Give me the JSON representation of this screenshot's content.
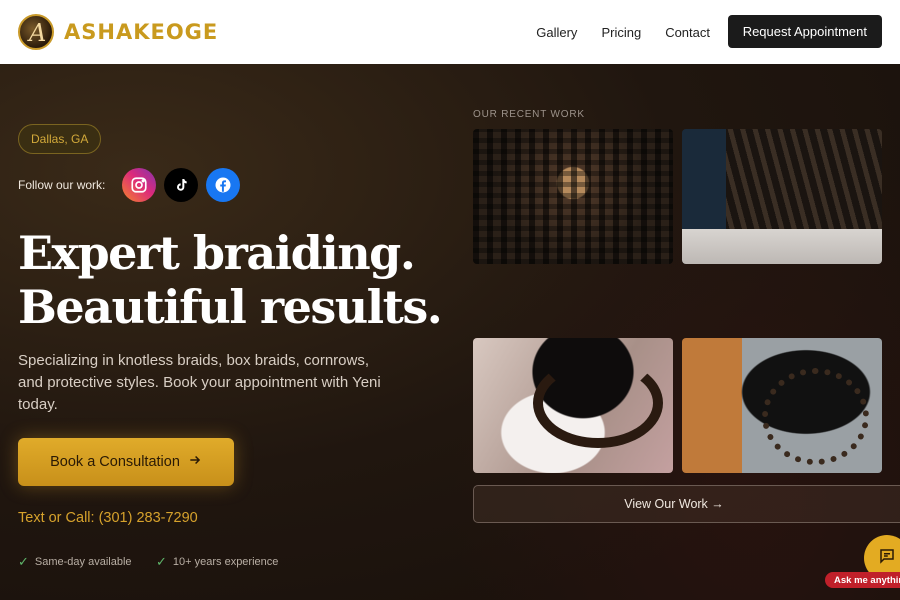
{
  "header": {
    "brand": "ASHAKEOGE",
    "nav": [
      "Gallery",
      "Pricing",
      "Contact"
    ],
    "cta": "Request Appointment"
  },
  "hero": {
    "location": "Dallas, GA",
    "follow_label": "Follow our work:",
    "socials": [
      "instagram-icon",
      "tiktok-icon",
      "facebook-icon"
    ],
    "headline_line1": "Expert braiding.",
    "headline_line2": "Beautiful results.",
    "subtext": "Specializing in knotless braids, box braids, cornrows, and protective styles. Book your appointment with Yeni today.",
    "cta": "Book a Consultation",
    "call": "Text or Call: (301) 283-7290",
    "features": [
      "Same-day available",
      "10+ years experience"
    ]
  },
  "gallery": {
    "label": "OUR RECENT WORK",
    "view_button": "View Our Work →"
  },
  "chat": {
    "tag": "Ask me anythin"
  },
  "colors": {
    "accent": "#d6a22c",
    "dark": "#1b120c"
  }
}
